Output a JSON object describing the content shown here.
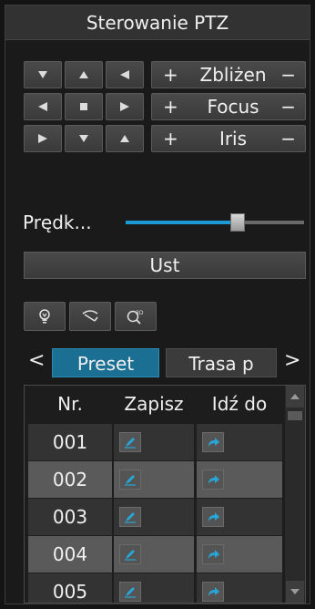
{
  "panel": {
    "title": "Sterowanie PTZ"
  },
  "direction_pad": {
    "up_left": "arrow-up-left-icon",
    "up": "arrow-up-icon",
    "up_right": "arrow-up-right-icon",
    "left": "arrow-left-icon",
    "stop": "stop-icon",
    "right": "arrow-right-icon",
    "down_left": "arrow-down-left-icon",
    "down": "arrow-down-icon",
    "down_right": "arrow-down-right-icon"
  },
  "lens_controls": [
    {
      "plus": "+",
      "label": "Zbliżen",
      "minus": "−"
    },
    {
      "plus": "+",
      "label": "Focus",
      "minus": "−"
    },
    {
      "plus": "+",
      "label": "Iris",
      "minus": "−"
    }
  ],
  "speed": {
    "label": "Prędk...",
    "value_fraction": 0.63
  },
  "settings_button": {
    "label": "Ust"
  },
  "tools": [
    {
      "icon": "light-bulb-icon"
    },
    {
      "icon": "wiper-icon"
    },
    {
      "icon": "3d-position-icon"
    }
  ],
  "tabs": {
    "prev": "<",
    "next": ">",
    "items": [
      {
        "label": "Preset",
        "active": true
      },
      {
        "label": "Trasa p",
        "active": false
      }
    ]
  },
  "preset_table": {
    "columns": [
      "Nr.",
      "Zapisz",
      "Idź do"
    ],
    "rows": [
      {
        "nr": "001"
      },
      {
        "nr": "002"
      },
      {
        "nr": "003"
      },
      {
        "nr": "004"
      },
      {
        "nr": "005"
      }
    ]
  },
  "colors": {
    "accent": "#1e9ad6",
    "active_tab": "#1a6f93",
    "background": "#1a1a1a"
  }
}
